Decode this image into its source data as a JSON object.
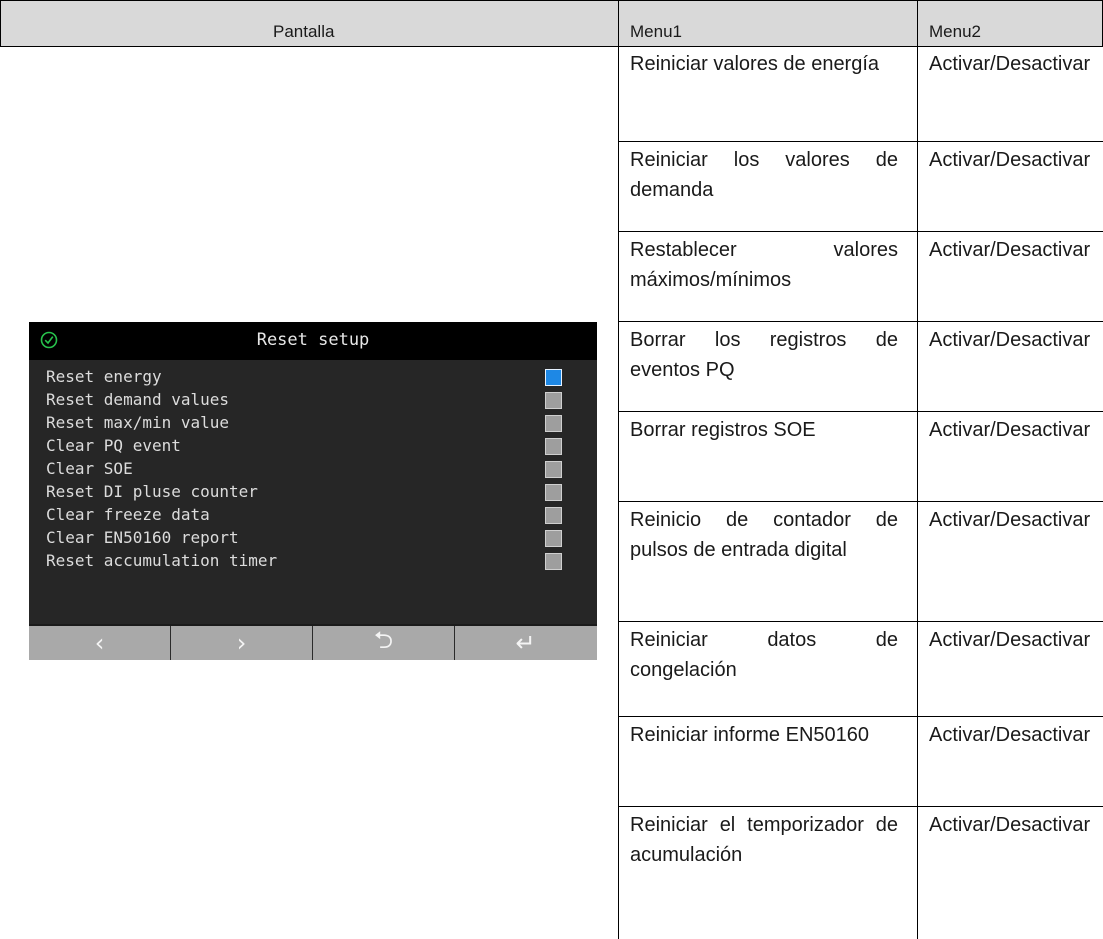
{
  "headers": {
    "col1": "Pantalla",
    "col2": "Menu1",
    "col3": "Menu2"
  },
  "rows": [
    {
      "menu1": "Reiniciar valores de energía",
      "menu2": "Activar/Desactivar"
    },
    {
      "menu1": "Reiniciar los valores de demanda",
      "menu2": "Activar/Desactivar"
    },
    {
      "menu1": "Restablecer valores máximos/mínimos",
      "menu2": "Activar/Desactivar"
    },
    {
      "menu1": "Borrar los registros de eventos PQ",
      "menu2": "Activar/Desactivar"
    },
    {
      "menu1": "Borrar registros SOE",
      "menu2": "Activar/Desactivar"
    },
    {
      "menu1": "Reinicio de contador de pulsos de entrada digital",
      "menu2": "Activar/Desactivar"
    },
    {
      "menu1": "Reiniciar datos de congelación",
      "menu2": "Activar/Desactivar"
    },
    {
      "menu1": "Reiniciar informe EN50160",
      "menu2": "Activar/Desactivar"
    },
    {
      "menu1": "Reiniciar el temporizador de acumulación",
      "menu2": "Activar/Desactivar"
    }
  ],
  "screen": {
    "title": "Reset setup",
    "status_icon": "check-circle-icon",
    "items": [
      {
        "label": "Reset energy",
        "checked": true
      },
      {
        "label": "Reset demand values",
        "checked": false
      },
      {
        "label": "Reset max/min value",
        "checked": false
      },
      {
        "label": "Clear PQ event",
        "checked": false
      },
      {
        "label": "Clear SOE",
        "checked": false
      },
      {
        "label": "Reset DI pluse counter",
        "checked": false
      },
      {
        "label": "Clear freeze data",
        "checked": false
      },
      {
        "label": "Clear EN50160 report",
        "checked": false
      },
      {
        "label": "Reset accumulation timer",
        "checked": false
      }
    ],
    "nav": [
      {
        "glyph": "‹",
        "icon": "chevron-left-icon"
      },
      {
        "glyph": "›",
        "icon": "chevron-right-icon"
      },
      {
        "glyph": "⮌",
        "icon": "back-arrow-icon"
      },
      {
        "glyph": "↵",
        "icon": "enter-icon"
      }
    ],
    "colors": {
      "checked": "#1e88e5",
      "unchecked": "#9e9e9e",
      "ok": "#27c24c"
    }
  }
}
